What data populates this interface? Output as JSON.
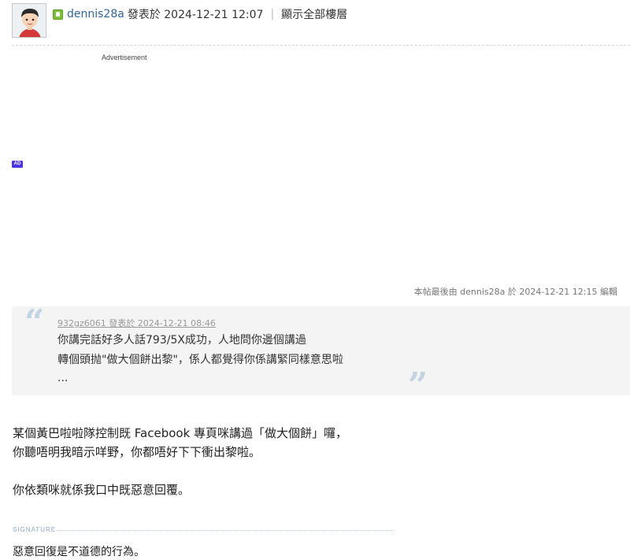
{
  "post": {
    "author": "dennis28a",
    "posted_at": "發表於 2024-12-21 12:07",
    "separator": "|",
    "show_all_floors": "顯示全部樓層",
    "advertisement_label": "Advertisement",
    "ad_badge": "AD",
    "edit_note": "本帖最後由 dennis28a 於 2024-12-21 12:15 編輯"
  },
  "quote": {
    "cite": "932gz6061 發表於 2024-12-21 08:46",
    "lines": [
      "你講完話好多人話793/5X成功，人地問你邊個講過",
      "轉個頭抛\"做大個餅出黎\"，係人都覺得你係講緊同樣意思啦",
      "..."
    ],
    "open_mark": "“",
    "close_mark": "”"
  },
  "body": {
    "lines": [
      "某個黃巴啦啦隊控制既 Facebook 專頁咪講過「做大個餅」囉，",
      "你聽唔明我暗示咩野，你都唔好下下衝出黎啦。",
      "你依類咪就係我口中既惡意回覆。"
    ]
  },
  "signature": {
    "label": "SIGNATURE",
    "text": "惡意回復是不道德的行為。"
  },
  "colors": {
    "link": "#336699",
    "quote_bg": "#f4f4f4",
    "quote_mark": "#c4d3e2",
    "online_icon": "#7fbf3f",
    "ad_badge": "#4a35e0"
  }
}
